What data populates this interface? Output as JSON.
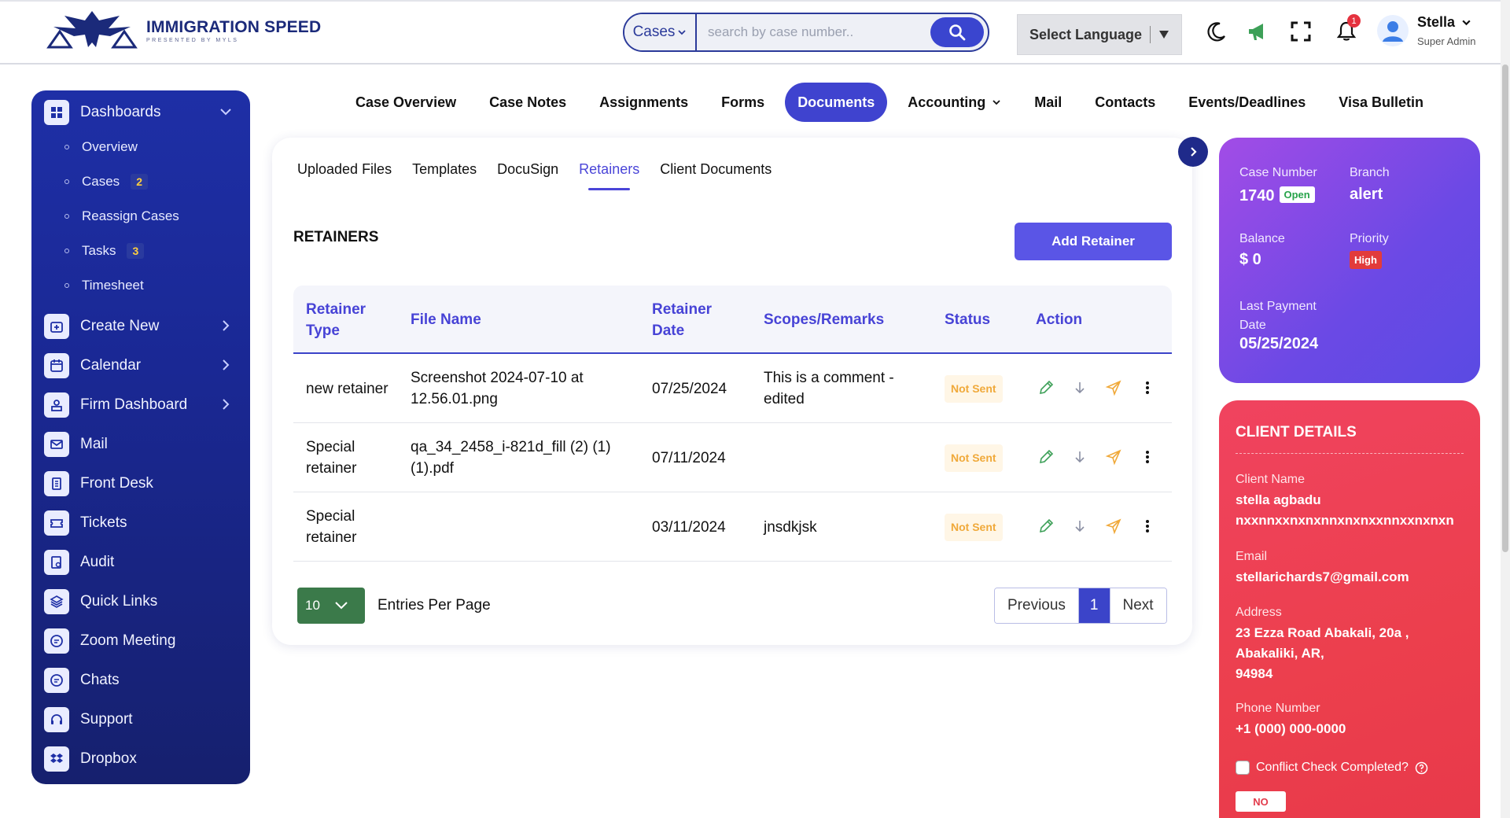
{
  "header": {
    "logo_title": "IMMIGRATION SPEED",
    "logo_sub": "PRESENTED BY MYLS",
    "search_type": "Cases",
    "search_placeholder": "search by case number..",
    "language": "Select Language",
    "notification_count": "1",
    "user_name": "Stella",
    "user_role": "Super Admin"
  },
  "sidebar": {
    "dashboards": "Dashboards",
    "sub_items": [
      {
        "label": "Overview",
        "count": ""
      },
      {
        "label": "Cases",
        "count": "2"
      },
      {
        "label": "Reassign Cases",
        "count": ""
      },
      {
        "label": "Tasks",
        "count": "3"
      },
      {
        "label": "Timesheet",
        "count": ""
      }
    ],
    "items": [
      {
        "label": "Create New",
        "icon": "create-new-icon"
      },
      {
        "label": "Calendar",
        "icon": "calendar-icon"
      },
      {
        "label": "Firm Dashboard",
        "icon": "firm-dashboard-icon"
      },
      {
        "label": "Mail",
        "icon": "mail-icon"
      },
      {
        "label": "Front Desk",
        "icon": "front-desk-icon"
      },
      {
        "label": "Tickets",
        "icon": "ticket-icon"
      },
      {
        "label": "Audit",
        "icon": "audit-icon"
      },
      {
        "label": "Quick Links",
        "icon": "layers-icon"
      },
      {
        "label": "Zoom Meeting",
        "icon": "chat-icon"
      },
      {
        "label": "Chats",
        "icon": "chat-icon"
      },
      {
        "label": "Support",
        "icon": "headset-icon"
      },
      {
        "label": "Dropbox",
        "icon": "dropbox-icon"
      }
    ]
  },
  "tabs": [
    "Case Overview",
    "Case Notes",
    "Assignments",
    "Forms",
    "Documents",
    "Accounting",
    "Mail",
    "Contacts",
    "Events/Deadlines",
    "Visa Bulletin"
  ],
  "active_tab": "Documents",
  "subtabs": [
    "Uploaded Files",
    "Templates",
    "DocuSign",
    "Retainers",
    "Client Documents"
  ],
  "active_subtab": "Retainers",
  "retainers": {
    "title": "RETAINERS",
    "add_button": "Add Retainer",
    "columns": [
      "Retainer Type",
      "File Name",
      "Retainer Date",
      "Scopes/Remarks",
      "Status",
      "Action"
    ],
    "rows": [
      {
        "type": "new retainer",
        "file": "Screenshot 2024-07-10 at 12.56.01.png",
        "date": "07/25/2024",
        "remarks": "This is a comment - edited",
        "status": "Not Sent"
      },
      {
        "type": "Special retainer",
        "file": "qa_34_2458_i-821d_fill (2) (1) (1).pdf",
        "date": "07/11/2024",
        "remarks": "",
        "status": "Not Sent"
      },
      {
        "type": "Special retainer",
        "file": "",
        "date": "03/11/2024",
        "remarks": "jnsdkjsk",
        "status": "Not Sent"
      }
    ],
    "per_page": "10",
    "per_page_label": "Entries Per Page",
    "prev": "Previous",
    "page": "1",
    "next": "Next"
  },
  "case": {
    "number_label": "Case Number",
    "number": "1740",
    "status": "Open",
    "branch_label": "Branch",
    "branch": "alert",
    "balance_label": "Balance",
    "balance": "$ 0",
    "priority_label": "Priority",
    "priority": "High",
    "last_payment_label_1": "Last Payment",
    "last_payment_label_2": "Date",
    "last_payment": "05/25/2024"
  },
  "client": {
    "title": "CLIENT DETAILS",
    "name_label": "Client Name",
    "name_1": "stella agbadu",
    "name_2": "nxxnnxxnxnxnnxnxnxxnnxxnxnxn",
    "email_label": "Email",
    "email": "stellarichards7@gmail.com",
    "address_label": "Address",
    "address_1": "23 Ezza Road Abakali, 20a ,",
    "address_2": "Abakaliki, AR,",
    "address_3": "94984",
    "phone_label": "Phone Number",
    "phone": "+1 (000) 000-0000",
    "conflict_label": "Conflict Check Completed?",
    "conflict_value": "NO"
  },
  "colors": {
    "primary": "#3f43cf",
    "sidebar": "#1a2894",
    "case_panel": "#6b49e5",
    "client_panel": "#ec3f4d",
    "status_not_sent": "#f0a93a"
  }
}
